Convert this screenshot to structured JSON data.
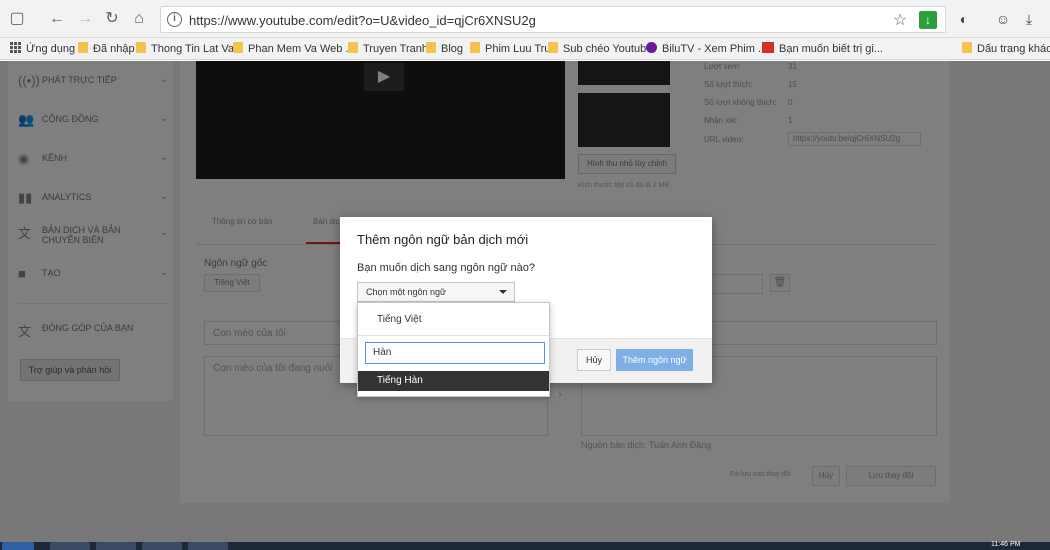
{
  "browser": {
    "url": "https://www.youtube.com/edit?o=U&video_id=qjCr6XNSU2g",
    "bookmarks": [
      "Ứng dụng",
      "Đã nhập",
      "Thong Tin Lat Vat",
      "Phan Mem Va Web ...",
      "Truyen Tranh",
      "Blog",
      "Phim Luu Tru",
      "Sub chéo Youtube",
      "BiluTV - Xem Phim ...",
      "Bạn muốn biết trị gi...",
      "Dấu trang khác"
    ]
  },
  "sidebar": {
    "items": [
      {
        "label": "PHÁT TRỰC TIẾP",
        "icon": "live-icon"
      },
      {
        "label": "CỘNG ĐỒNG",
        "icon": "community-icon"
      },
      {
        "label": "KÊNH",
        "icon": "channel-icon"
      },
      {
        "label": "ANALYTICS",
        "icon": "analytics-icon"
      },
      {
        "label": "BẢN DỊCH VÀ BẢN CHUYỂN BIÊN",
        "icon": "translate-icon"
      },
      {
        "label": "TẠO",
        "icon": "create-icon"
      },
      {
        "label": "ĐÓNG GÓP CỦA BẠN",
        "icon": "contribution-icon"
      }
    ],
    "help_button": "Trợ giúp và phản hồi"
  },
  "video": {
    "stats": [
      {
        "label": "Lượt xem:",
        "value": "31"
      },
      {
        "label": "Số lượt thích:",
        "value": "15"
      },
      {
        "label": "Số lượt không thích:",
        "value": "0"
      },
      {
        "label": "Nhận xét:",
        "value": "1"
      }
    ],
    "url_label": "URL video:",
    "url_value": "https://youtu.be/qjCr6XNSU2g",
    "custom_thumb_button": "Hình thu nhỏ tùy chỉnh",
    "thumb_note": "Kích thước tệp tối đa là 2 MB."
  },
  "tabs": [
    "Thông tin cơ bản",
    "Bản dịch"
  ],
  "editor": {
    "source_lang_label": "Ngôn ngữ gốc",
    "source_lang_value": "Tiếng Việt",
    "title_value": "Con mèo của tôi",
    "desc_value": "Con mèo của tôi đang nuôi",
    "attribution": "Nguồn bản dịch: Tuấn Anh Đặng",
    "saved_status": "Đã lưu mọi thay đổi",
    "cancel": "Hủy",
    "save": "Lưu thay đổi"
  },
  "dialog": {
    "title": "Thêm ngôn ngữ bản dịch mới",
    "question": "Bạn muốn dịch sang ngôn ngữ nào?",
    "select_placeholder": "Chọn một ngôn ngữ",
    "cancel": "Hủy",
    "add": "Thêm ngôn ngữ"
  },
  "dropdown": {
    "first_option": "Tiếng Việt",
    "search_value": "Hàn",
    "highlighted_option": "Tiếng Hàn"
  },
  "taskbar": {
    "clock": "11:46 PM"
  }
}
